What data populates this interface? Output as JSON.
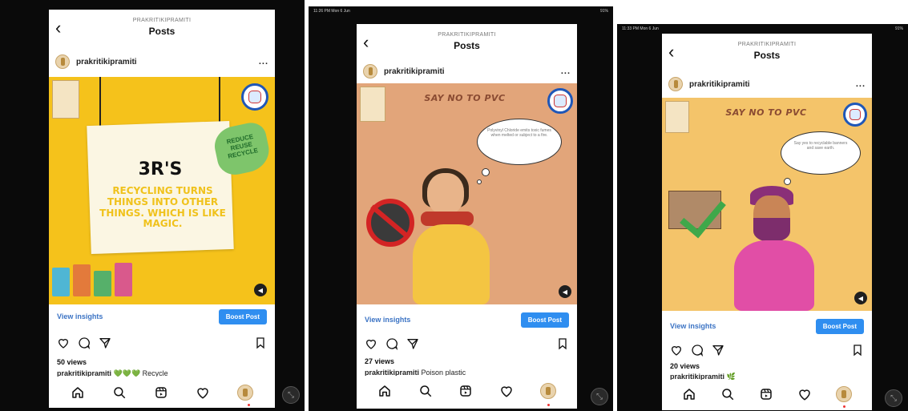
{
  "screens": [
    {
      "status": {
        "time": "",
        "battery": ""
      },
      "header": {
        "account": "PRAKRITIKIPRAMITI",
        "title": "Posts"
      },
      "user": {
        "name": "prakritikipramiti",
        "more": "..."
      },
      "post": {
        "title": "3R'S",
        "slogan": "RECYCLING TURNS THINGS INTO OTHER THINGS. WHICH IS LIKE MAGIC.",
        "badge": "REDUCE REUSE RECYCLE",
        "bg_color": "#f5c21b"
      },
      "insights": {
        "view_label": "View insights",
        "boost_label": "Boost Post"
      },
      "views": "50 views",
      "caption": {
        "user": "prakritikipramiti",
        "text": "💚💚💚 Recycle"
      }
    },
    {
      "status": {
        "time": "11:26 PM  Mon 6 Jun",
        "battery": "91%"
      },
      "header": {
        "account": "PRAKRITIKIPRAMITI",
        "title": "Posts"
      },
      "user": {
        "name": "prakritikipramiti",
        "more": "..."
      },
      "post": {
        "headline": "SAY NO TO PVC",
        "bubble": "Polyvinyl Chloride emits toxic fumes when melted or subject to a fire.",
        "bg_color": "#e2a57a"
      },
      "insights": {
        "view_label": "View insights",
        "boost_label": "Boost Post"
      },
      "views": "27 views",
      "caption": {
        "user": "prakritikipramiti",
        "text": "Poison plastic"
      }
    },
    {
      "status": {
        "time": "11:33 PM  Mon 6 Jun",
        "battery": "91%"
      },
      "header": {
        "account": "PRAKRITIKIPRAMITI",
        "title": "Posts"
      },
      "user": {
        "name": "prakritikipramiti",
        "more": "..."
      },
      "post": {
        "headline": "SAY NO TO PVC",
        "bubble": "Say yes to recyclable banners and save earth.",
        "bg_color": "#f4c46a"
      },
      "insights": {
        "view_label": "View insights",
        "boost_label": "Boost Post"
      },
      "views": "20 views",
      "caption": {
        "user": "prakritikipramiti",
        "text": "🌿"
      }
    }
  ],
  "icons": {
    "back": "‹",
    "volume": "◀",
    "zoom": "⤡"
  },
  "colors": {
    "link_blue": "#3b73c4",
    "boost_blue": "#2f8ef0",
    "frame_black": "#0a0a0a"
  }
}
